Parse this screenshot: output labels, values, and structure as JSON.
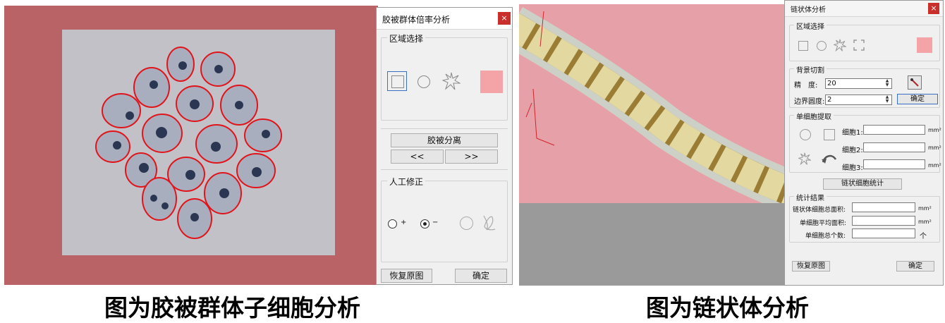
{
  "left_dialog": {
    "title": "胶被群体倍率分析",
    "close_label": "×",
    "region_group_label": "区域选择",
    "separate_button": "胶被分离",
    "prev_button": "<<",
    "next_button": ">>",
    "manual_group_label": "人工修正",
    "plus_label": "+",
    "minus_label": "−",
    "restore_button": "恢复原图",
    "confirm_button": "确定",
    "swatch_color": "#f4a3a6"
  },
  "right_dialog": {
    "title": "链状体分析",
    "close_label": "×",
    "region_group_label": "区域选择",
    "background_group_label": "背景切割",
    "precision_label": "精　度:",
    "precision_value": "20",
    "border_label": "边界圆度:",
    "border_value": "2",
    "confirm_small_button": "确定",
    "cell_group_label": "单细胞提取",
    "cell1_label": "细胞1:",
    "cell2_label": "细胞2:",
    "cell3_label": "细胞3:",
    "unit_mm2": "mm²",
    "chain_stats_button": "链状细胞统计",
    "stats_group_label": "统计结果",
    "total_area_label": "链状体细胞总面积:",
    "avg_area_label": "单细胞平均面积:",
    "count_label": "单细胞总个数:",
    "count_unit": "个",
    "restore_button": "恢复原图",
    "confirm_button": "确定",
    "swatch_color": "#f4a3a6"
  },
  "captions": {
    "left": "图为胶被群体子细胞分析",
    "right": "图为链状体分析"
  },
  "colors": {
    "left_bg_mask": "#b96366",
    "cell_outline": "#e0141a",
    "chain_bg_mask": "#e6a0a8",
    "bottom_gray": "#9a9a9a"
  }
}
